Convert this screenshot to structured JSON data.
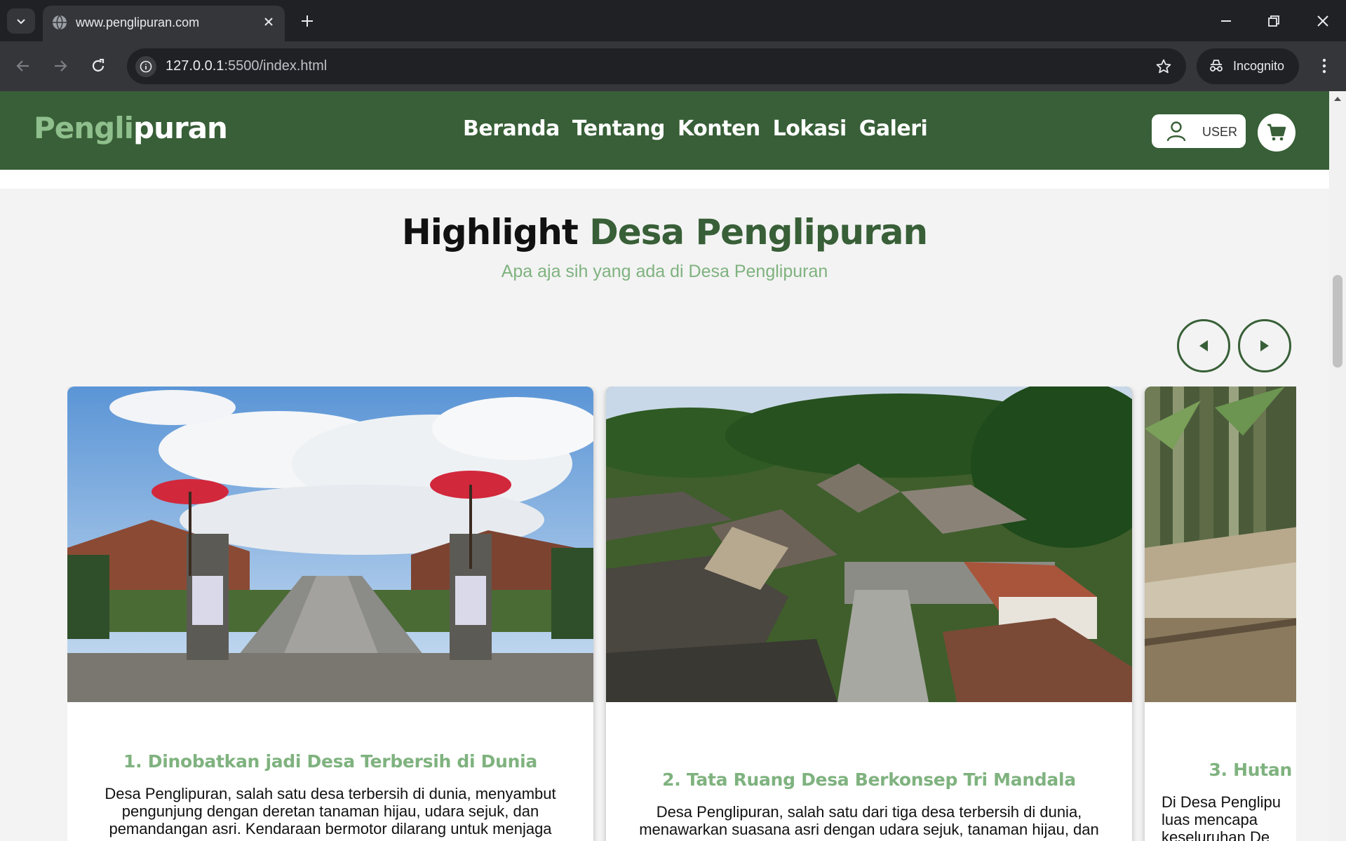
{
  "browser": {
    "tab_title": "www.penglipuran.com",
    "url_host": "127.0.0.1",
    "url_rest": ":5500/index.html",
    "incognito_label": "Incognito"
  },
  "site": {
    "logo_part1": "Pengli",
    "logo_part2": "puran",
    "menu": [
      "Beranda",
      "Tentang",
      "Konten",
      "Lokasi",
      "Galeri"
    ],
    "user_label": "USER",
    "colors": {
      "primary": "#385f37",
      "accent": "#7fb27f"
    }
  },
  "highlight": {
    "title_dark": "Highlight",
    "title_green": "Desa Penglipuran",
    "subtitle": "Apa aja sih yang ada di Desa Penglipuran",
    "cards": [
      {
        "title": "1. Dinobatkan jadi Desa Terbersih di Dunia",
        "text": "Desa Penglipuran, salah satu desa terbersih di dunia, menyambut pengunjung dengan deretan tanaman hijau, udara sejuk, dan pemandangan asri. Kendaraan bermotor dilarang untuk menjaga"
      },
      {
        "title": "2. Tata Ruang Desa Berkonsep Tri Mandala",
        "text": "Desa Penglipuran, salah satu dari tiga desa terbersih di dunia, menawarkan suasana asri dengan udara sejuk, tanaman hijau, dan"
      },
      {
        "title": "3. Hutan",
        "text": "Di Desa Penglipu luas mencapa keseluruhan De"
      }
    ]
  }
}
